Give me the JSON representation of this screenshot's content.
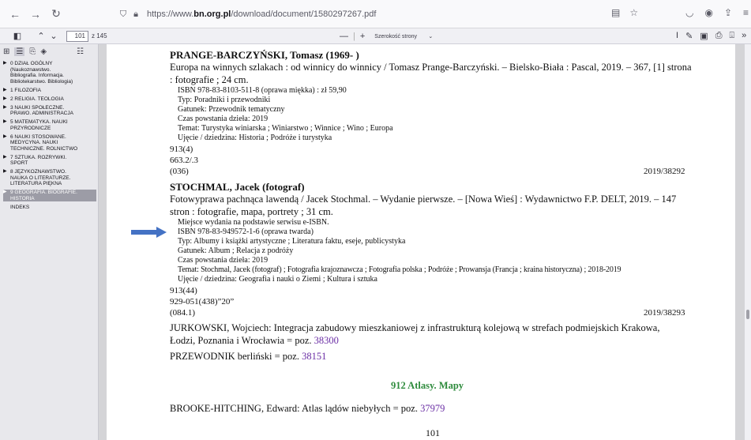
{
  "browser": {
    "url_prefix": "https://www.",
    "url_domain": "bn.org.pl",
    "url_path": "/download/document/1580297267.pdf",
    "icons": [
      "back-arrow-icon",
      "forward-arrow-icon",
      "reload-icon",
      "shield-icon",
      "lock-icon"
    ]
  },
  "pdf_toolbar": {
    "current_page": "101",
    "page_of": "z 145",
    "zoom_minus": "—",
    "zoom_plus": "+",
    "zoom_value": "Szerokość strony"
  },
  "sidebar": {
    "items": [
      {
        "label": "0 DZIAŁ OGÓLNY (Naukoznawstwo. Bibliografia. Informacja. Bibliotekarstwo. Bibliologia)",
        "lines": [
          "0 DZIAŁ OGÓLNY",
          "(Naukoznawstwo.",
          "Bibliografia. Informacja.",
          "Bibliotekarstwo. Bibliologia)"
        ]
      },
      {
        "label": "1 FILOZOFIA",
        "lines": [
          "1 FILOZOFIA"
        ]
      },
      {
        "label": "2 RELIGIA. TEOLOGIA",
        "lines": [
          "2 RELIGIA. TEOLOGIA"
        ]
      },
      {
        "label": "3 NAUKI SPOŁECZNE. PRAWO. ADMINISTRACJA",
        "lines": [
          "3 NAUKI SPOŁECZNE.",
          "PRAWO. ADMINISTRACJA"
        ]
      },
      {
        "label": "5 MATEMATYKA. NAUKI PRZYRODNICZE",
        "lines": [
          "5 MATEMATYKA. NAUKI",
          "PRZYRODNICZE"
        ]
      },
      {
        "label": "6 NAUKI STOSOWANE. MEDYCYNA. NAUKI TECHNICZNE. ROLNICTWO",
        "lines": [
          "6 NAUKI STOSOWANE.",
          "MEDYCYNA. NAUKI",
          "TECHNICZNE. ROLNICTWO"
        ]
      },
      {
        "label": "7 SZTUKA. ROZRYWKI. SPORT",
        "lines": [
          "7 SZTUKA. ROZRYWKI.",
          "SPORT"
        ]
      },
      {
        "label": "8 JĘZYKOZNAWSTWO. NAUKA O LITERATURZE. LITERATURA PIĘKNA",
        "lines": [
          "8 JĘZYKOZNAWSTWO.",
          "NAUKA O LITERATURZE.",
          "LITERATURA PIĘKNA"
        ]
      },
      {
        "label": "9 GEOGRAFIA. BIOGRAFIE. HISTORIA",
        "lines": [
          "9 GEOGRAFIA. BIOGRAFIE.",
          "HISTORIA"
        ],
        "selected": true
      },
      {
        "label": "INDEKS",
        "lines": [
          "INDEKS"
        ],
        "noarrow": true
      }
    ]
  },
  "document": {
    "entry1": {
      "head": "PRANGE-BARCZYŃSKI, Tomasz (1969- )",
      "title_line1": "Europa na winnych szlakach : od winnicy do winnicy / Tomasz Prange-Barczyński. – Bielsko-Biała : Pascal, 2019. – 367, [1] strona",
      "title_line2": ": fotografie ; 24 cm.",
      "details": [
        "ISBN 978-83-8103-511-8 (oprawa miękka) : zł 59,90",
        "Typ: Poradniki i przewodniki",
        "Gatunek: Przewodnik tematyczny",
        "Czas powstania dzieła: 2019",
        "Temat: Turystyka winiarska ; Winiarstwo ; Winnice ; Wino ; Europa",
        "Ujęcie / dziedzina: Historia ; Podróże i turystyka"
      ],
      "class1": "913(4)",
      "class2": "663.2/.3",
      "class3": "(036)",
      "number": "2019/38292"
    },
    "entry2": {
      "head": "STOCHMAL, Jacek (fotograf)",
      "title_line1": "Fotowyprawa pachnąca lawendą / Jacek Stochmal. – Wydanie pierwsze. – [Nowa Wieś] : Wydawnictwo F.P. DELT, 2019. – 147",
      "title_line2": "stron : fotografie, mapa, portrety ; 31 cm.",
      "details": [
        "Miejsce wydania na podstawie serwisu e-ISBN.",
        "ISBN 978-83-949572-1-6 (oprawa twarda)",
        "Typ: Albumy i książki artystyczne ; Literatura faktu, eseje, publicystyka",
        "Gatunek: Album ; Relacja z podróży",
        "Czas powstania dzieła: 2019",
        "Temat: Stochmal, Jacek (fotograf) ; Fotografia krajoznawcza ; Fotografia polska ; Podróże ; Prowansja (Francja ; kraina historyczna) ; 2018-2019",
        "Ujęcie / dziedzina: Geografia i nauki o Ziemi ; Kultura i sztuka"
      ],
      "class1": "913(44)",
      "class2": "929-051(438)”20”",
      "class3": "(084.1)",
      "number": "2019/38293"
    },
    "ref1_line1": "JURKOWSKI,  Wojciech: Integracja zabudowy mieszkaniowej z infrastrukturą kolejową w strefach podmiejskich Krakowa,",
    "ref1_line2": "Łodzi, Poznania i Wrocławia = poz. ",
    "ref1_link": "38300",
    "ref2_text": "PRZEWODNIK berliński = poz. ",
    "ref2_link": "38151",
    "section_heading": "912 Atlasy. Mapy",
    "ref3_text": "BROOKE-HITCHING, Edward: Atlas lądów niebyłych = poz. ",
    "ref3_link": "37979",
    "page_number": "101",
    "accent_color": "#4472c4"
  }
}
